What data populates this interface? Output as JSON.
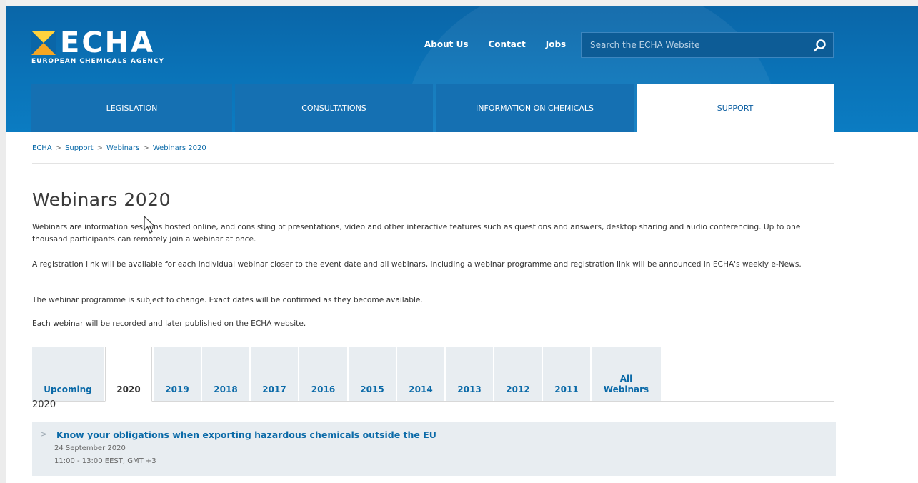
{
  "header": {
    "logo_text": "ECHA",
    "logo_subtitle": "EUROPEAN CHEMICALS AGENCY",
    "top_links": [
      "About Us",
      "Contact",
      "Jobs"
    ],
    "search_placeholder": "Search the ECHA Website",
    "search_icon": "search-icon",
    "brand_color": "#0a73b8",
    "accent_color": "#f5a623"
  },
  "nav": {
    "tabs": [
      {
        "label": "LEGISLATION",
        "active": false
      },
      {
        "label": "CONSULTATIONS",
        "active": false
      },
      {
        "label": "INFORMATION ON CHEMICALS",
        "active": false
      },
      {
        "label": "SUPPORT",
        "active": true
      }
    ]
  },
  "breadcrumb": [
    "ECHA",
    "Support",
    "Webinars",
    "Webinars 2020"
  ],
  "page": {
    "title": "Webinars 2020",
    "paragraphs": [
      "Webinars are information sessions hosted online, and consisting of presentations, video and other interactive features such as questions and answers, desktop sharing and audio conferencing. Up to one thousand participants can remotely join a webinar at once.",
      "A registration link will be available for each individual webinar closer to the event date and all webinars, including a webinar programme and registration link will be announced in ECHA's weekly e-News.",
      "The webinar programme is subject to change. Exact dates will be confirmed as they become available.",
      "Each webinar will be recorded and later published on the ECHA website."
    ]
  },
  "year_tabs": {
    "items": [
      "Upcoming",
      "2020",
      "2019",
      "2018",
      "2017",
      "2016",
      "2015",
      "2014",
      "2013",
      "2012",
      "2011",
      "All Webinars"
    ],
    "active": "2020"
  },
  "section": {
    "year_label": "2020",
    "events": [
      {
        "title": "Know your obligations when exporting hazardous chemicals outside the EU",
        "date": "24 September 2020",
        "time": "11:00 - 13:00 EEST, GMT +3"
      }
    ]
  }
}
